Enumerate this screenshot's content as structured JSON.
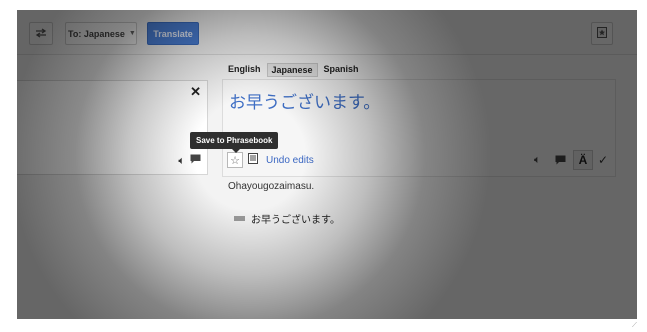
{
  "toolbar": {
    "swap_icon": "swap-icon",
    "target_language_label": "To: Japanese",
    "translate_label": "Translate",
    "phrasebook_icon": "phrasebook-icon"
  },
  "source_panel": {
    "close_icon": "close-icon",
    "speaker_icon": "speaker-icon",
    "comment_icon": "comment-icon"
  },
  "output": {
    "tabs": [
      "English",
      "Japanese",
      "Spanish"
    ],
    "active_tab": "Japanese",
    "translation": "お早うございます。",
    "undo_label": "Undo edits",
    "romanization": "Ohayougozaimasu.",
    "dictionary_entry": "お早うございます。"
  },
  "tooltip": {
    "text": "Save to Phrasebook"
  },
  "colors": {
    "translate_button": "#4a7fd6",
    "translation_text": "#3e6ec4",
    "link": "#3a67c2",
    "tooltip_bg": "#2f2f2f"
  }
}
